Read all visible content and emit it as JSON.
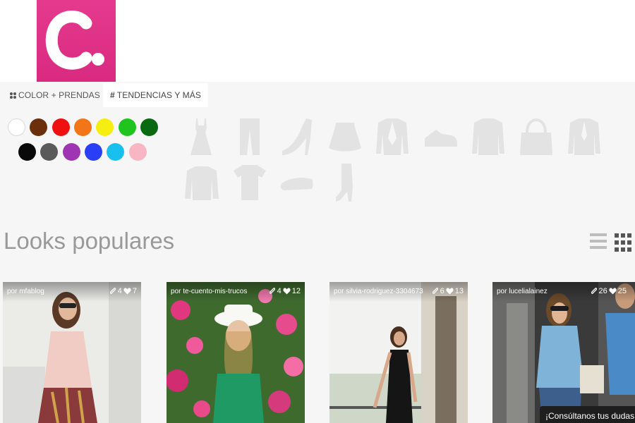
{
  "brand": {
    "logo_letter": "C.",
    "logo_color": "#e0348a"
  },
  "tabs": [
    {
      "label": "COLOR + PRENDAS",
      "icon": "grid-dots-icon"
    },
    {
      "label": "TENDENCIAS Y MÁS",
      "icon": "hashtag-icon",
      "active": true
    }
  ],
  "colors": {
    "row1": [
      "#ffffff",
      "#6b2f0c",
      "#f01010",
      "#f27518",
      "#f5ee10",
      "#1fc41f",
      "#0a6a12"
    ],
    "row2": [
      "#0a0a0a",
      "#5a5a5a",
      "#a035b3",
      "#2a3ef5",
      "#18c0ee",
      "#f7b6c2"
    ]
  },
  "garments": [
    "dress-icon",
    "pants-icon",
    "high-heel-icon",
    "skirt-icon",
    "blazer-icon",
    "sneaker-icon",
    "shirt-icon",
    "handbag-icon",
    "coat-icon",
    "sweater-icon",
    "tshirt-icon",
    "flat-shoe-icon",
    "boot-icon"
  ],
  "section": {
    "title": "Looks populares"
  },
  "looks": [
    {
      "author": "por mfablog",
      "clips": "4",
      "likes": "7"
    },
    {
      "author": "por te-cuento-mis-trucos",
      "clips": "4",
      "likes": "12"
    },
    {
      "author": "por silvia-rodriguez-3304673",
      "clips": "6",
      "likes": "13"
    },
    {
      "author": "por lucelialainez",
      "clips": "26",
      "likes": "25"
    }
  ],
  "chat": {
    "label": "¡Consúltanos tus dudas s"
  }
}
